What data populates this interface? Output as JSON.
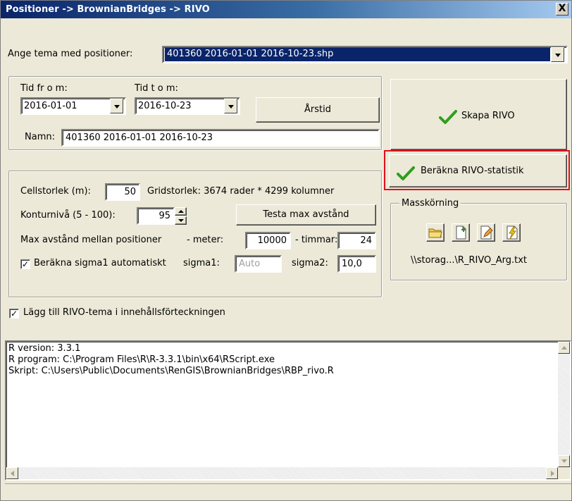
{
  "window": {
    "title": "Positioner -> BrownianBridges -> RIVO",
    "close_glyph": "X"
  },
  "theme": {
    "label": "Ange tema med positioner:",
    "value": "401360 2016-01-01 2016-10-23.shp"
  },
  "dates": {
    "from_label": "Tid fr o m:",
    "from_value": "2016-01-01",
    "to_label": "Tid t o m:",
    "to_value": "2016-10-23",
    "season_button": "Årstid",
    "name_label": "Namn:",
    "name_value": "401360 2016-01-01 2016-10-23"
  },
  "actions": {
    "create_rivo": "Skapa RIVO",
    "compute_stats": "Beräkna RIVO-statistik"
  },
  "params": {
    "cellsize_label": "Cellstorlek (m):",
    "cellsize_value": "50",
    "gridsize_text": "Gridstorlek: 3674 rader * 4299 kolumner",
    "contour_label": "Konturnivå (5 - 100):",
    "contour_value": "95",
    "test_button": "Testa max avstånd",
    "maxdist_label": "Max avstånd mellan positioner",
    "meter_label": "- meter:",
    "meter_value": "10000",
    "hours_label": "- timmar:",
    "hours_value": "24",
    "auto_sigma_label": "Beräkna sigma1 automatiskt",
    "sigma1_label": "sigma1:",
    "sigma1_placeholder": "Auto",
    "sigma2_label": "sigma2:",
    "sigma2_value": "10,0"
  },
  "batch": {
    "title": "Masskörning",
    "icons": [
      "open-folder-icon",
      "new-file-icon",
      "edit-file-icon",
      "run-lightning-icon"
    ],
    "file_path": "\\\\storag...\\R_RIVO_Arg.txt"
  },
  "add_to_toc_label": "Lägg till RIVO-tema i innehållsförteckningen",
  "log": {
    "lines": [
      "R version: 3.3.1",
      "R program: C:\\Program Files\\R\\R-3.3.1\\bin\\x64\\RScript.exe",
      "Skript: C:\\Users\\Public\\Documents\\RenGIS\\BrownianBridges\\RBP_rivo.R"
    ]
  },
  "colors": {
    "highlight_border": "#e0101a",
    "checkmark_green": "#2e9e1e",
    "selection_blue": "#0a246a"
  }
}
